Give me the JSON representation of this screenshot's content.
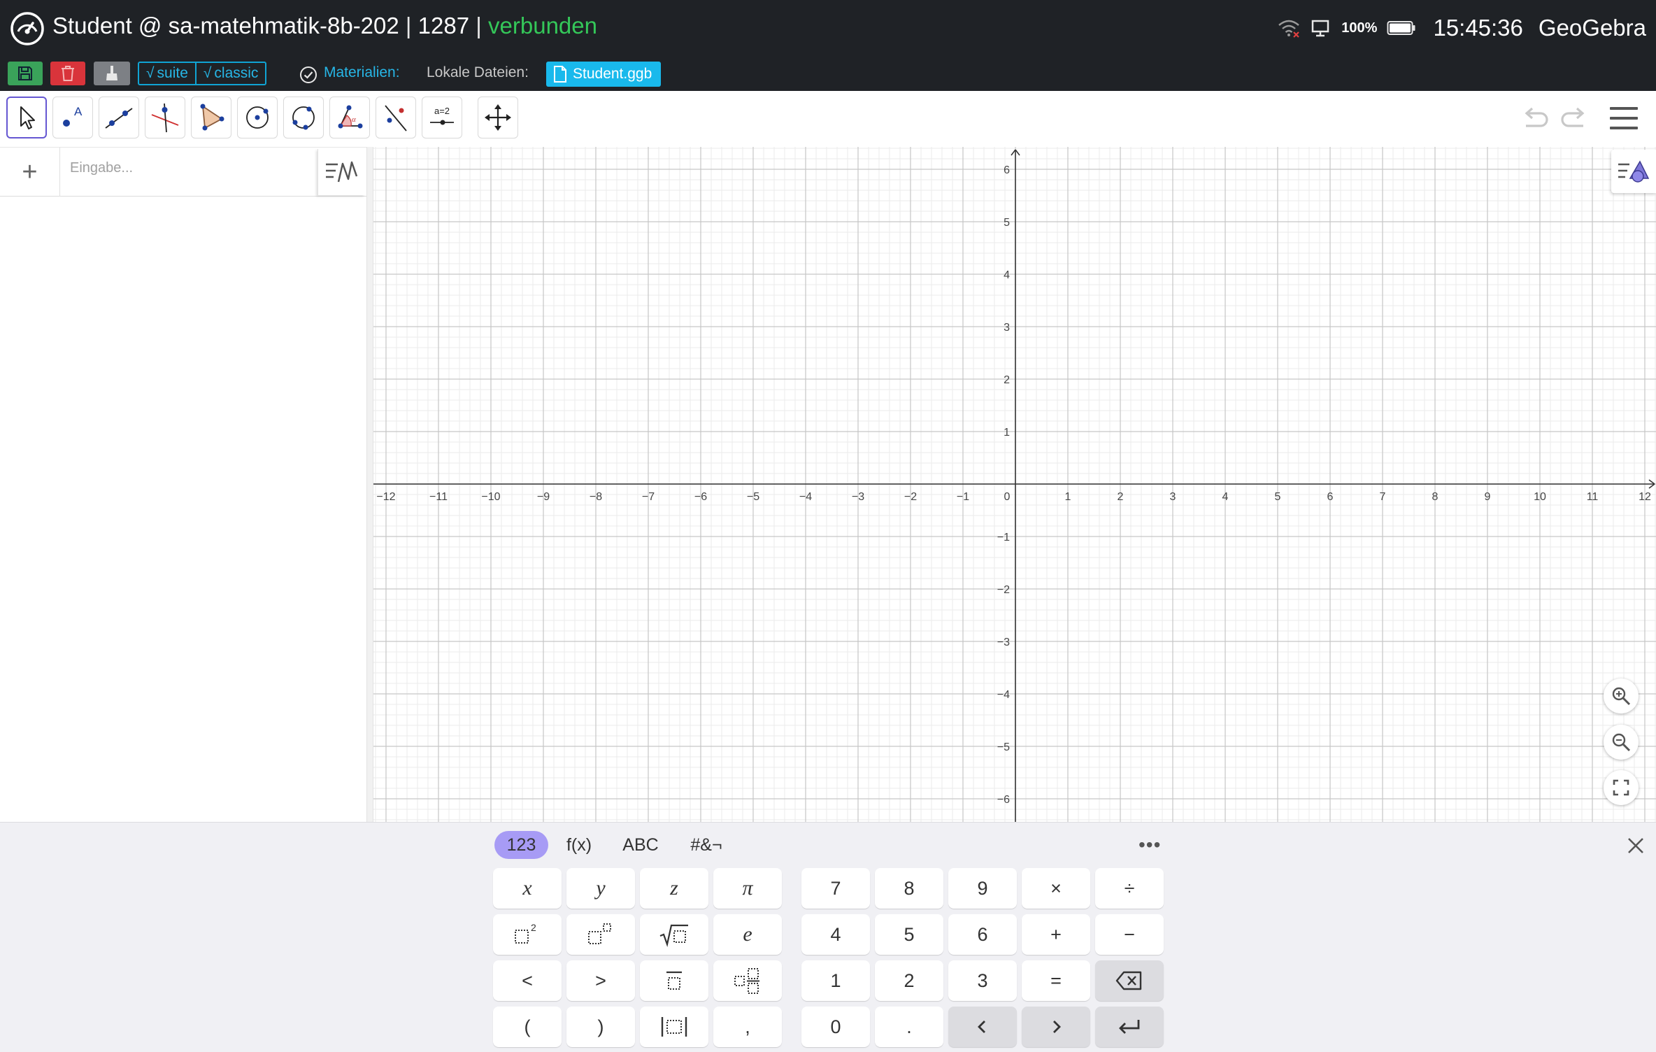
{
  "titlebar": {
    "user": "Student @ sa-matehmatik-8b-202",
    "session": "1287",
    "status": "verbunden",
    "battery": "100%",
    "clock": "15:45:36",
    "app": "GeoGebra",
    "icons": [
      "gauge-icon",
      "wifi-off-icon",
      "display-icon",
      "battery-icon"
    ],
    "status_color": "#34c759"
  },
  "actionbar": {
    "suite_label": "suite",
    "classic_label": "classic",
    "materialien_label": "Materialien:",
    "lokale_label": "Lokale Dateien:",
    "file_name": "Student.ggb",
    "accent": "#19b9ec",
    "buttons": [
      {
        "name": "save",
        "icon": "floppy-disk-icon",
        "color": "#3aa35a"
      },
      {
        "name": "delete",
        "icon": "trash-icon",
        "color": "#d9343b"
      },
      {
        "name": "clean",
        "icon": "broom-icon",
        "color": "#7d8085"
      }
    ]
  },
  "toolbar": {
    "tools": [
      {
        "name": "move",
        "icon": "arrow-cursor-icon",
        "active": true
      },
      {
        "name": "point",
        "icon": "point-icon"
      },
      {
        "name": "line",
        "icon": "line-icon"
      },
      {
        "name": "perpendicular",
        "icon": "perpendicular-icon"
      },
      {
        "name": "polygon",
        "icon": "polygon-icon"
      },
      {
        "name": "circle",
        "icon": "circle-icon"
      },
      {
        "name": "circle-3-points",
        "icon": "circle-3-points-icon"
      },
      {
        "name": "angle",
        "icon": "angle-icon"
      },
      {
        "name": "reflect",
        "icon": "reflect-icon"
      },
      {
        "name": "slider",
        "icon": "slider-icon",
        "label": "a=2"
      },
      {
        "name": "move-view",
        "icon": "move-view-icon"
      }
    ],
    "slider_label": "a=2",
    "active_color": "#6557d2"
  },
  "algebra": {
    "add_label": "+",
    "input_placeholder": "Eingabe..."
  },
  "graphics": {
    "x_ticks": [
      "−12",
      "−11",
      "−10",
      "−9",
      "−8",
      "−7",
      "−6",
      "−5",
      "−4",
      "−3",
      "−2",
      "−1",
      "0",
      "1",
      "2",
      "3",
      "4",
      "5",
      "6",
      "7",
      "8",
      "9",
      "10",
      "11",
      "12"
    ],
    "y_ticks": [
      "6",
      "5",
      "4",
      "3",
      "2",
      "1",
      "−1",
      "−2",
      "−3",
      "−4",
      "−5",
      "−6"
    ]
  },
  "keyboard": {
    "tabs": [
      {
        "label": "123",
        "active": true
      },
      {
        "label": "f(x)"
      },
      {
        "label": "ABC"
      },
      {
        "label": "#&¬"
      }
    ],
    "more_label": "•••",
    "tab_active_color": "#a79bf5",
    "left_keys": [
      {
        "label": "x",
        "italic": true
      },
      {
        "label": "y",
        "italic": true
      },
      {
        "label": "z",
        "italic": true
      },
      {
        "label": "π",
        "italic": true
      },
      {
        "icon": "square-icon"
      },
      {
        "icon": "power-icon"
      },
      {
        "icon": "sqrt-icon"
      },
      {
        "label": "e",
        "italic": true
      },
      {
        "label": "<"
      },
      {
        "label": ">"
      },
      {
        "icon": "fraction-icon"
      },
      {
        "icon": "mixed-fraction-icon"
      },
      {
        "label": "("
      },
      {
        "label": ")"
      },
      {
        "icon": "abs-icon"
      },
      {
        "label": ","
      }
    ],
    "right_keys": [
      {
        "label": "7"
      },
      {
        "label": "8"
      },
      {
        "label": "9"
      },
      {
        "label": "×"
      },
      {
        "label": "÷"
      },
      {
        "label": "4"
      },
      {
        "label": "5"
      },
      {
        "label": "6"
      },
      {
        "label": "+"
      },
      {
        "label": "−"
      },
      {
        "label": "1"
      },
      {
        "label": "2"
      },
      {
        "label": "3"
      },
      {
        "label": "="
      },
      {
        "icon": "backspace-icon"
      },
      {
        "label": "0"
      },
      {
        "label": "."
      },
      {
        "icon": "arrow-left-icon"
      },
      {
        "icon": "arrow-right-icon"
      },
      {
        "icon": "enter-icon"
      }
    ]
  }
}
